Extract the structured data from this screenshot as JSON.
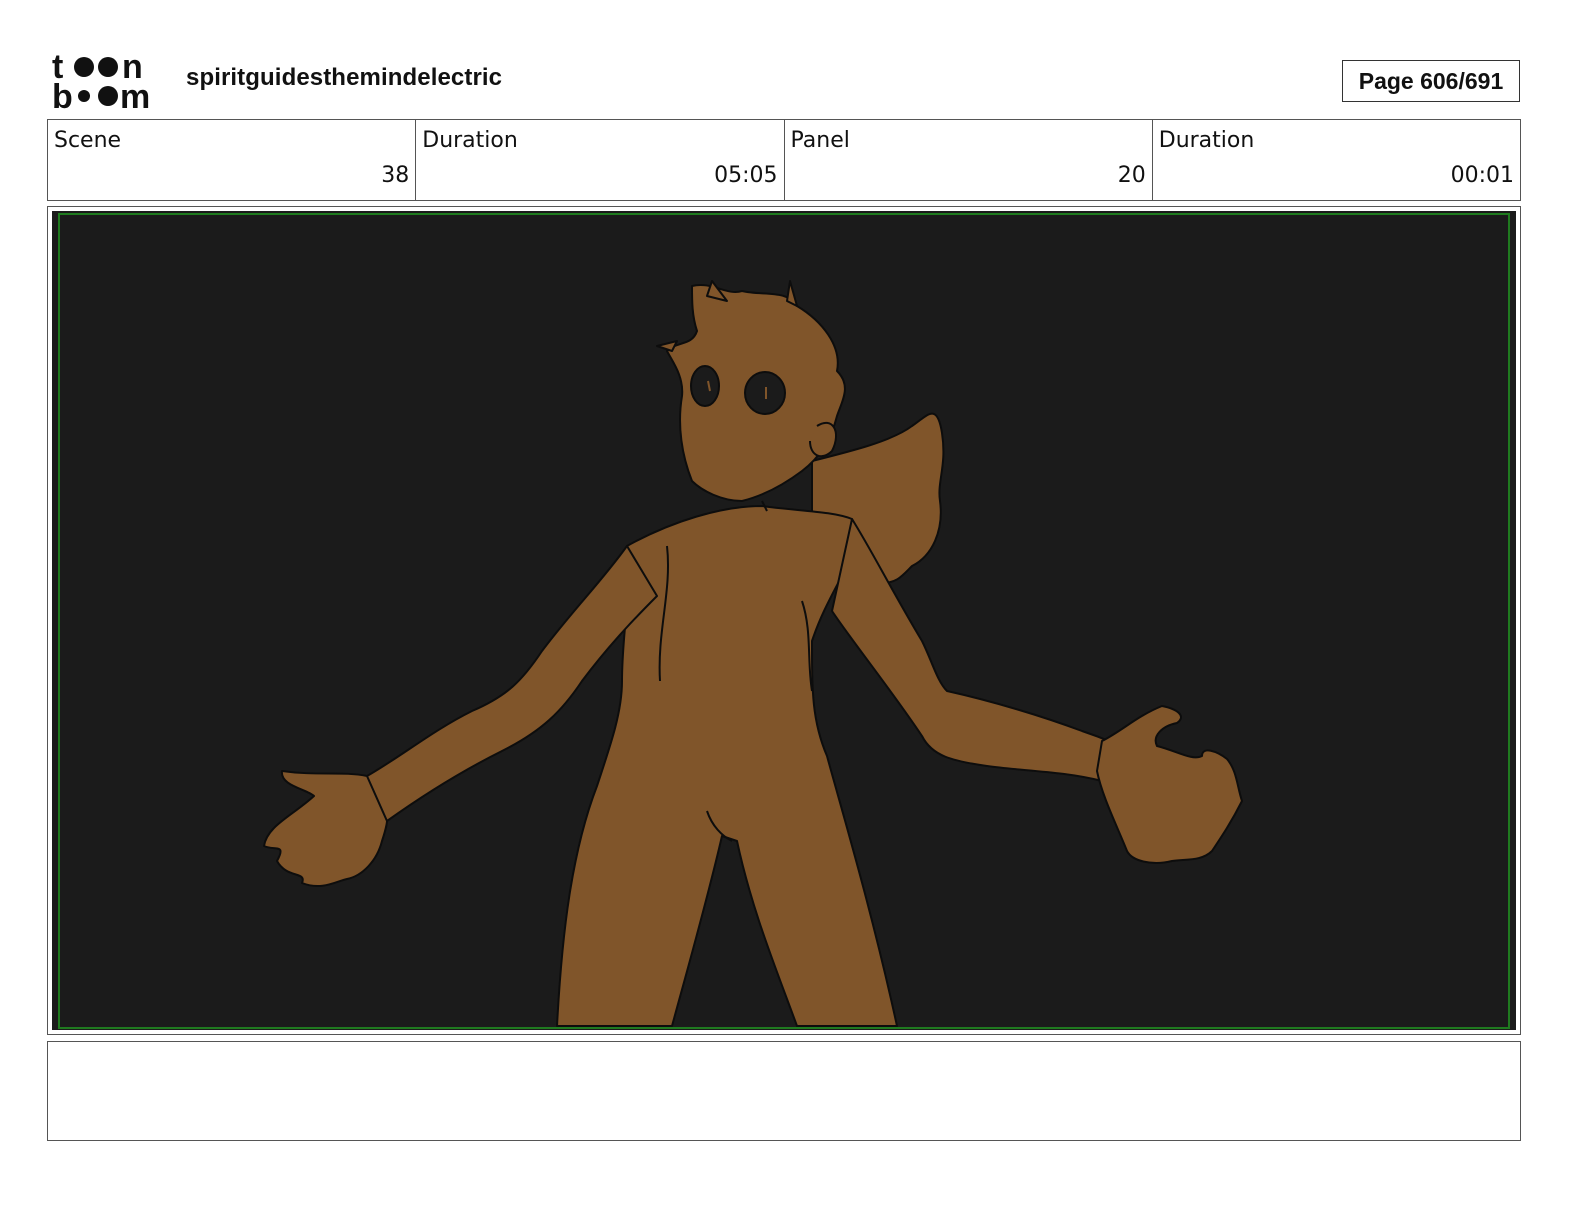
{
  "header": {
    "logo_text": "toon boom",
    "project_title": "spiritguidesthemindelectric",
    "page": "Page 606/691"
  },
  "info": {
    "scene_label": "Scene",
    "scene_value": "38",
    "scene_duration_label": "Duration",
    "scene_duration_value": "05:05",
    "panel_label": "Panel",
    "panel_value": "20",
    "panel_duration_label": "Duration",
    "panel_duration_value": "00:01"
  },
  "panel": {
    "background_color": "#1b1b1b",
    "figure_color": "#80552a",
    "safe_area_color": "#1f7a1f"
  },
  "notes": {
    "text": ""
  }
}
